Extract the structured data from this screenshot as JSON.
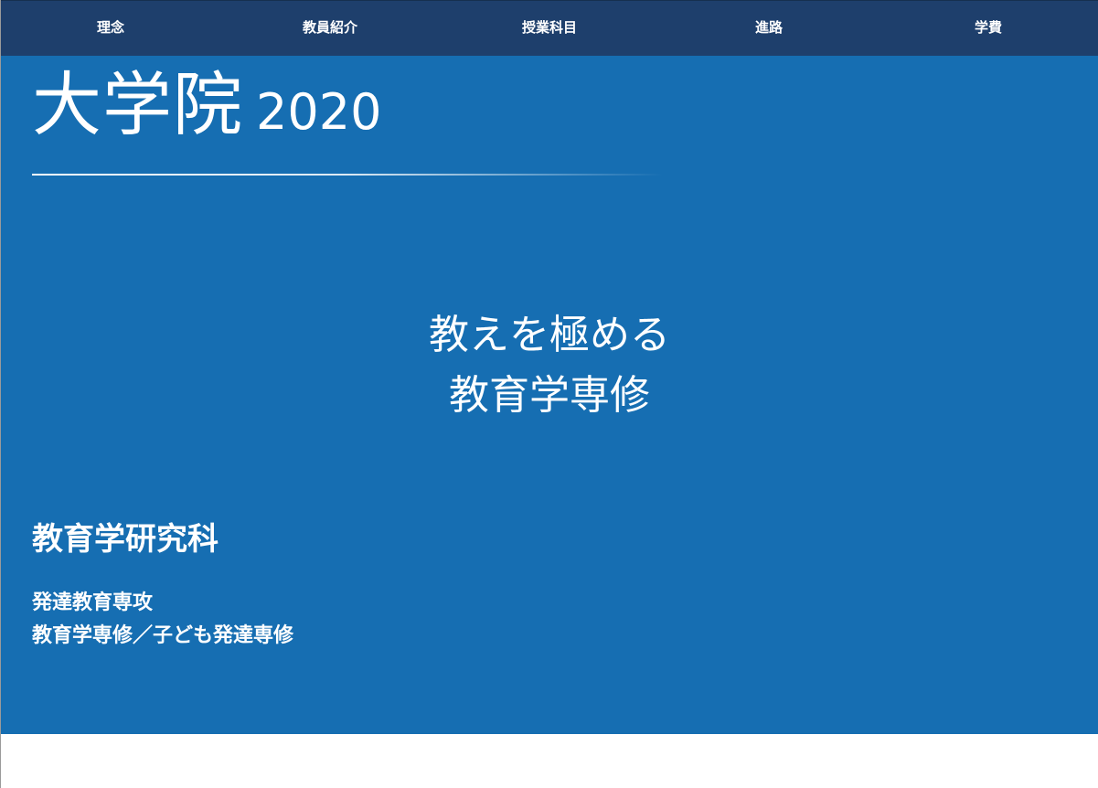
{
  "nav": {
    "items": [
      {
        "label": "理念"
      },
      {
        "label": "教員紹介"
      },
      {
        "label": "授業科目"
      },
      {
        "label": "進路"
      },
      {
        "label": "学費"
      }
    ]
  },
  "hero": {
    "title": "大学院",
    "year": "2020",
    "tagline_line1": "教えを極める",
    "tagline_line2": "教育学専修",
    "graduate_school": "教育学研究科",
    "department_line1": "発達教育専攻",
    "department_line2": "教育学専修／子ども発達専修"
  },
  "colors": {
    "nav_background": "#1e3f6c",
    "hero_background": "#166eb2",
    "text": "#ffffff"
  }
}
